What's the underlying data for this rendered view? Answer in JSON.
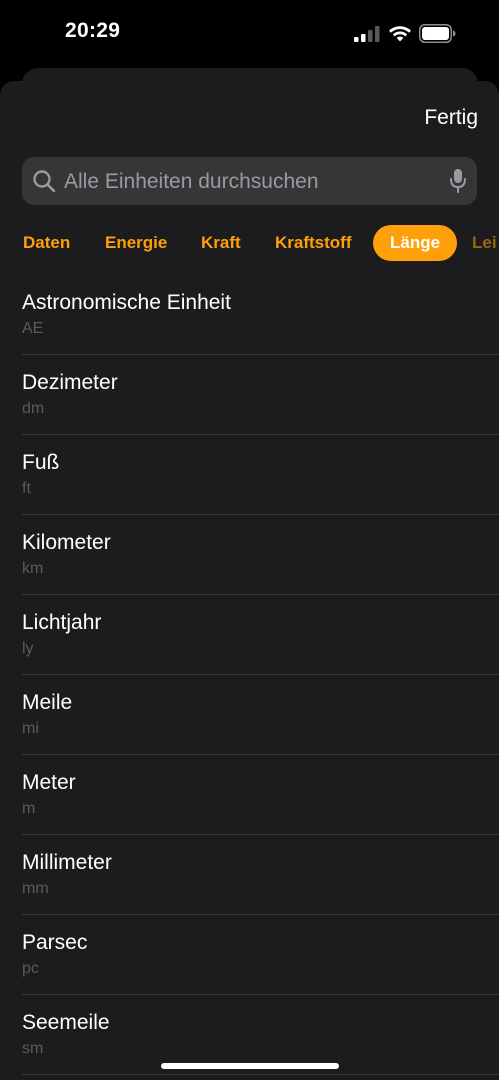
{
  "status_bar": {
    "time": "20:29",
    "icons": [
      "signal-icon",
      "wifi-icon",
      "battery-icon"
    ]
  },
  "header": {
    "done_label": "Fertig"
  },
  "search": {
    "placeholder": "Alle Einheiten durchsuchen",
    "icons": [
      "search-icon",
      "microphone-icon"
    ]
  },
  "tabs": [
    {
      "label": "Daten",
      "active": false
    },
    {
      "label": "Energie",
      "active": false
    },
    {
      "label": "Kraft",
      "active": false
    },
    {
      "label": "Kraftstoff",
      "active": false
    },
    {
      "label": "Länge",
      "active": true
    },
    {
      "label": "Lei",
      "active": false
    }
  ],
  "units": [
    {
      "name": "Astronomische Einheit",
      "abbr": "AE"
    },
    {
      "name": "Dezimeter",
      "abbr": "dm"
    },
    {
      "name": "Fuß",
      "abbr": "ft"
    },
    {
      "name": "Kilometer",
      "abbr": "km"
    },
    {
      "name": "Lichtjahr",
      "abbr": "ly"
    },
    {
      "name": "Meile",
      "abbr": "mi"
    },
    {
      "name": "Meter",
      "abbr": "m"
    },
    {
      "name": "Millimeter",
      "abbr": "mm"
    },
    {
      "name": "Parsec",
      "abbr": "pc"
    },
    {
      "name": "Seemeile",
      "abbr": "sm"
    }
  ],
  "colors": {
    "accent": "#ff9f0a",
    "sheet_background": "#1c1c1e",
    "search_background": "#363638"
  }
}
